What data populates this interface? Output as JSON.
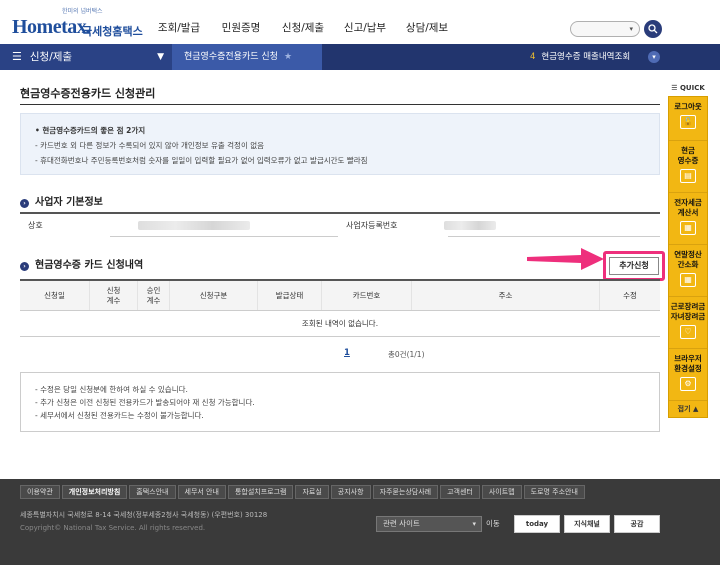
{
  "header": {
    "logo_tagline": "한미의 넘버택스",
    "logo_brand": "Hometax.",
    "logo_sub": "국세청홈택스",
    "gnb": [
      "조회/발급",
      "민원증명",
      "신청/제출",
      "신고/납부",
      "상담/제보"
    ],
    "search_caret": "▾",
    "search_icon": "magnifier-icon"
  },
  "navbar": {
    "menu_label": "신청/제출",
    "current_label": "현금영수증전용카드 신청",
    "right_num": "4",
    "right_label": "현금영수증 매출내역조회"
  },
  "quick": {
    "title": "QUICK",
    "items": [
      {
        "label1": "로그아웃",
        "label2": "",
        "icon": "lock-icon"
      },
      {
        "label1": "현금",
        "label2": "영수증",
        "icon": "receipt-icon"
      },
      {
        "label1": "전자세금",
        "label2": "계산서",
        "icon": "invoice-icon"
      },
      {
        "label1": "연말정산",
        "label2": "간소화",
        "icon": "calculator-icon"
      },
      {
        "label1": "근로장려금",
        "label2": "자녀장려금",
        "icon": "heart-icon"
      },
      {
        "label1": "브라우저",
        "label2": "환경설정",
        "icon": "gear-icon"
      }
    ],
    "close_label": "접기 ▲"
  },
  "main": {
    "page_title": "현금영수증전용카드 신청관리",
    "info": {
      "head": "• 현금영수증카드의 좋은 점 2가지",
      "lines": [
        "- 카드번호 외 다른 정보가 수록되어 있지 않아 개인정보 유출 걱정이 없음",
        "- 휴대전화번호나 주민등록번호처럼 숫자를 일일이 입력할 필요가 없어 입력오류가 없고 발급시간도 빨라짐"
      ]
    },
    "biz_section_title": "사업자 기본정보",
    "biz_fields": [
      {
        "label": "상호"
      },
      {
        "label": "사업자등록번호"
      }
    ],
    "card_section_title": "현금영수증 카드 신청내역",
    "add_button": "추가신청",
    "columns": [
      {
        "l1": "신청일",
        "l2": ""
      },
      {
        "l1": "신청",
        "l2": "계수"
      },
      {
        "l1": "승인",
        "l2": "계수"
      },
      {
        "l1": "신청구분",
        "l2": ""
      },
      {
        "l1": "발급상태",
        "l2": ""
      },
      {
        "l1": "카드번호",
        "l2": ""
      },
      {
        "l1": "주소",
        "l2": ""
      },
      {
        "l1": "수정",
        "l2": ""
      }
    ],
    "empty_message": "조회된 내역이 없습니다.",
    "page_number": "1",
    "total_text": "총0건(1/1)",
    "notes": [
      "- 수정은 당일 신청분에 한하여 하실 수 있습니다.",
      "- 추가 신청은 이전 신청된 전용카드가 발송되어야 재 신청 가능합니다.",
      "- 세무서에서 신청된 전용카드는 수정이 불가능합니다."
    ]
  },
  "footer": {
    "links": [
      "이용약관",
      "개인정보처리방침",
      "홈택스안내",
      "세무서 안내",
      "통합설치프로그램",
      "자료실",
      "공지사항",
      "자주묻는상담사례",
      "고객센터",
      "사이트맵",
      "도로명 주소안내"
    ],
    "address": "세종특별자치시 국세청로 8-14 국세청(정부세종2청사 국세청동) (우편번호) 30128",
    "copyright": "Copyright© National Tax Service. All rights reserved.",
    "related_label": "관련 사이트",
    "go_label": "이동",
    "badges": [
      "today",
      "지식채널",
      "공감"
    ]
  }
}
